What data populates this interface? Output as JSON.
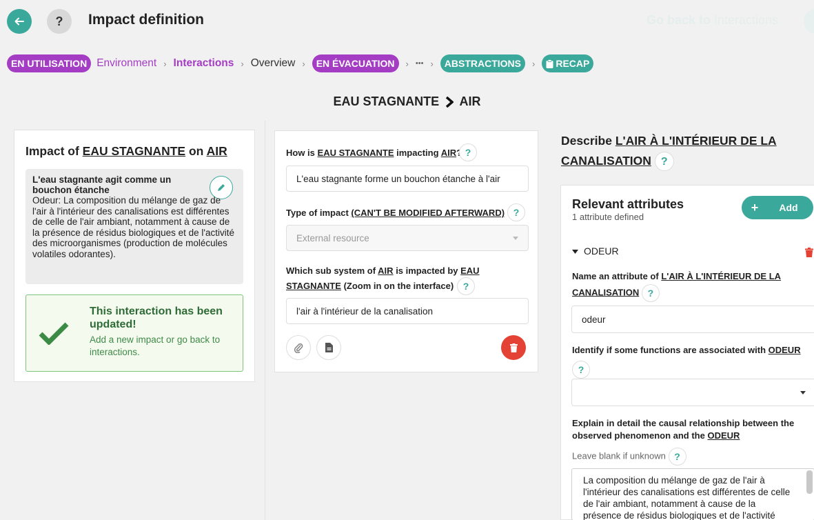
{
  "header": {
    "title": "Impact definition",
    "help_label": "?",
    "go_back_prefix": "Go back to",
    "go_back_target": "Interactions"
  },
  "breadcrumb": {
    "in_use": "EN UTILISATION",
    "environment": "Environment",
    "interactions": "Interactions",
    "overview": "Overview",
    "evacuation": "EN ÉVACUATION",
    "ellipsis": "•••",
    "abstractions": "ABSTRACTIONS",
    "recap": "RECAP"
  },
  "subject": {
    "source": "EAU STAGNANTE",
    "target": "AIR"
  },
  "left_panel": {
    "title_prefix": "Impact of",
    "title_source": "EAU STAGNANTE",
    "title_mid": "on",
    "title_target": "AIR",
    "note_title": "L'eau stagnante agit comme un bouchon étanche",
    "note_body": "Odeur: La composition du mélange de gaz de l'air à l'intérieur des canalisations est différentes de celle de l'air ambiant, notamment à cause de la présence de résidus biologiques et de l'activité des microorganismes (production de molécules volatiles odorantes).",
    "success_title": "This interaction has been updated!",
    "success_body": "Add a new impact or go back to interactions."
  },
  "middle_panel": {
    "q1_prefix": "How is",
    "q1_source": "EAU STAGNANTE",
    "q1_mid": "impacting",
    "q1_target": "AIR",
    "q1_suffix": "?",
    "q1_value": "L'eau stagnante forme un bouchon étanche à l'air",
    "q2_prefix": "Type of impact",
    "q2_note": "(CAN'T BE MODIFIED AFTERWARD)",
    "q2_value": "External resource",
    "q3_prefix": "Which sub system of",
    "q3_target": "AIR",
    "q3_mid": "is impacted by",
    "q3_source_a": "EAU",
    "q3_source_b": "STAGNANTE",
    "q3_suffix": "(Zoom in on the interface)",
    "q3_value": "l'air à l'intérieur de la canalisation"
  },
  "right_panel": {
    "describe_prefix": "Describe",
    "describe_target_a": "L'AIR À L'INTÉRIEUR DE LA",
    "describe_target_b": "CANALISATION",
    "attr_title": "Relevant attributes",
    "attr_count": "1 attribute defined",
    "add_label": "Add",
    "attribute_name": "ODEUR",
    "name_label_prefix": "Name an attribute of",
    "name_label_target_a": "L'AIR À L'INTÉRIEUR DE LA",
    "name_label_target_b": "CANALISATION",
    "name_value": "odeur",
    "functions_label_prefix": "Identify if some functions are associated with",
    "functions_label_target": "ODEUR",
    "functions_value": "",
    "causal_label_prefix": "Explain in detail the causal relationship between the observed phenomenon and the",
    "causal_label_target": "ODEUR",
    "causal_hint": "Leave blank if unknown",
    "causal_value": "La composition du mélange de gaz de l'air à l'intérieur des canalisations est différentes de celle de l'air ambiant, notamment à cause de la présence de résidus biologiques et de l'activité"
  },
  "colors": {
    "teal": "#3aa89a",
    "purple": "#a43cc4",
    "red": "#e34234",
    "success_green": "#2e6b37"
  },
  "icons": [
    "arrow-left-icon",
    "pencil-icon",
    "check-icon",
    "paperclip-icon",
    "document-icon",
    "trash-icon",
    "plus-icon",
    "caret-down-icon",
    "clipboard-icon",
    "chevron-right-icon"
  ]
}
